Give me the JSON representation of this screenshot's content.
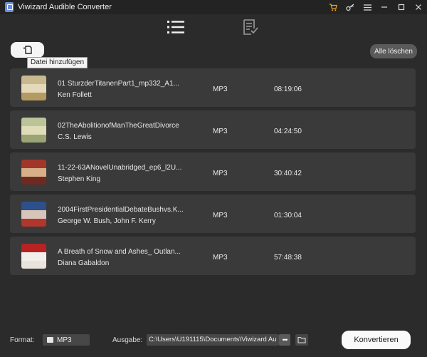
{
  "window": {
    "title": "Viwizard Audible Converter",
    "accent": "#f0a526"
  },
  "titlebar": {
    "icons": [
      "cart-icon",
      "key-icon",
      "menu-icon",
      "minimize-icon",
      "maximize-icon",
      "close-icon"
    ]
  },
  "toolbar": {
    "add_tooltip": "Datei hinzufügen",
    "clear_all_label": "Alle löschen"
  },
  "files": [
    {
      "title": "01 SturzderTitanenPart1_mp332_A1...",
      "author": "Ken Follett",
      "format": "MP3",
      "duration": "08:19:06",
      "cover": [
        "#c9b98f",
        "#e4d9b8",
        "#b49a62"
      ]
    },
    {
      "title": "02TheAbolitionofManTheGreatDivorce",
      "author": "C.S. Lewis",
      "format": "MP3",
      "duration": "04:24:50",
      "cover": [
        "#bcc59a",
        "#e1dcb8",
        "#9aa474"
      ]
    },
    {
      "title": "11-22-63ANovelUnabridged_ep6_l2U...",
      "author": "Stephen King",
      "format": "MP3",
      "duration": "30:40:42",
      "cover": [
        "#a3362b",
        "#d7b08a",
        "#6e2a22"
      ]
    },
    {
      "title": "2004FirstPresidentialDebateBushvs.K...",
      "author": "George W. Bush, John F. Kerry",
      "format": "MP3",
      "duration": "01:30:04",
      "cover": [
        "#2d4f8c",
        "#d6c5b8",
        "#b3362c"
      ]
    },
    {
      "title": "A Breath of Snow and Ashes_ Outlan...",
      "author": "Diana Gabaldon",
      "format": "MP3",
      "duration": "57:48:38",
      "cover": [
        "#b72222",
        "#f2efea",
        "#e9e4dc"
      ]
    }
  ],
  "bottom": {
    "format_label": "Format:",
    "format_value": "MP3",
    "output_label": "Ausgabe:",
    "output_path": "C:\\Users\\U191115\\Documents\\Viwizard Au",
    "browse_label": "•••",
    "convert_label": "Konvertieren"
  }
}
